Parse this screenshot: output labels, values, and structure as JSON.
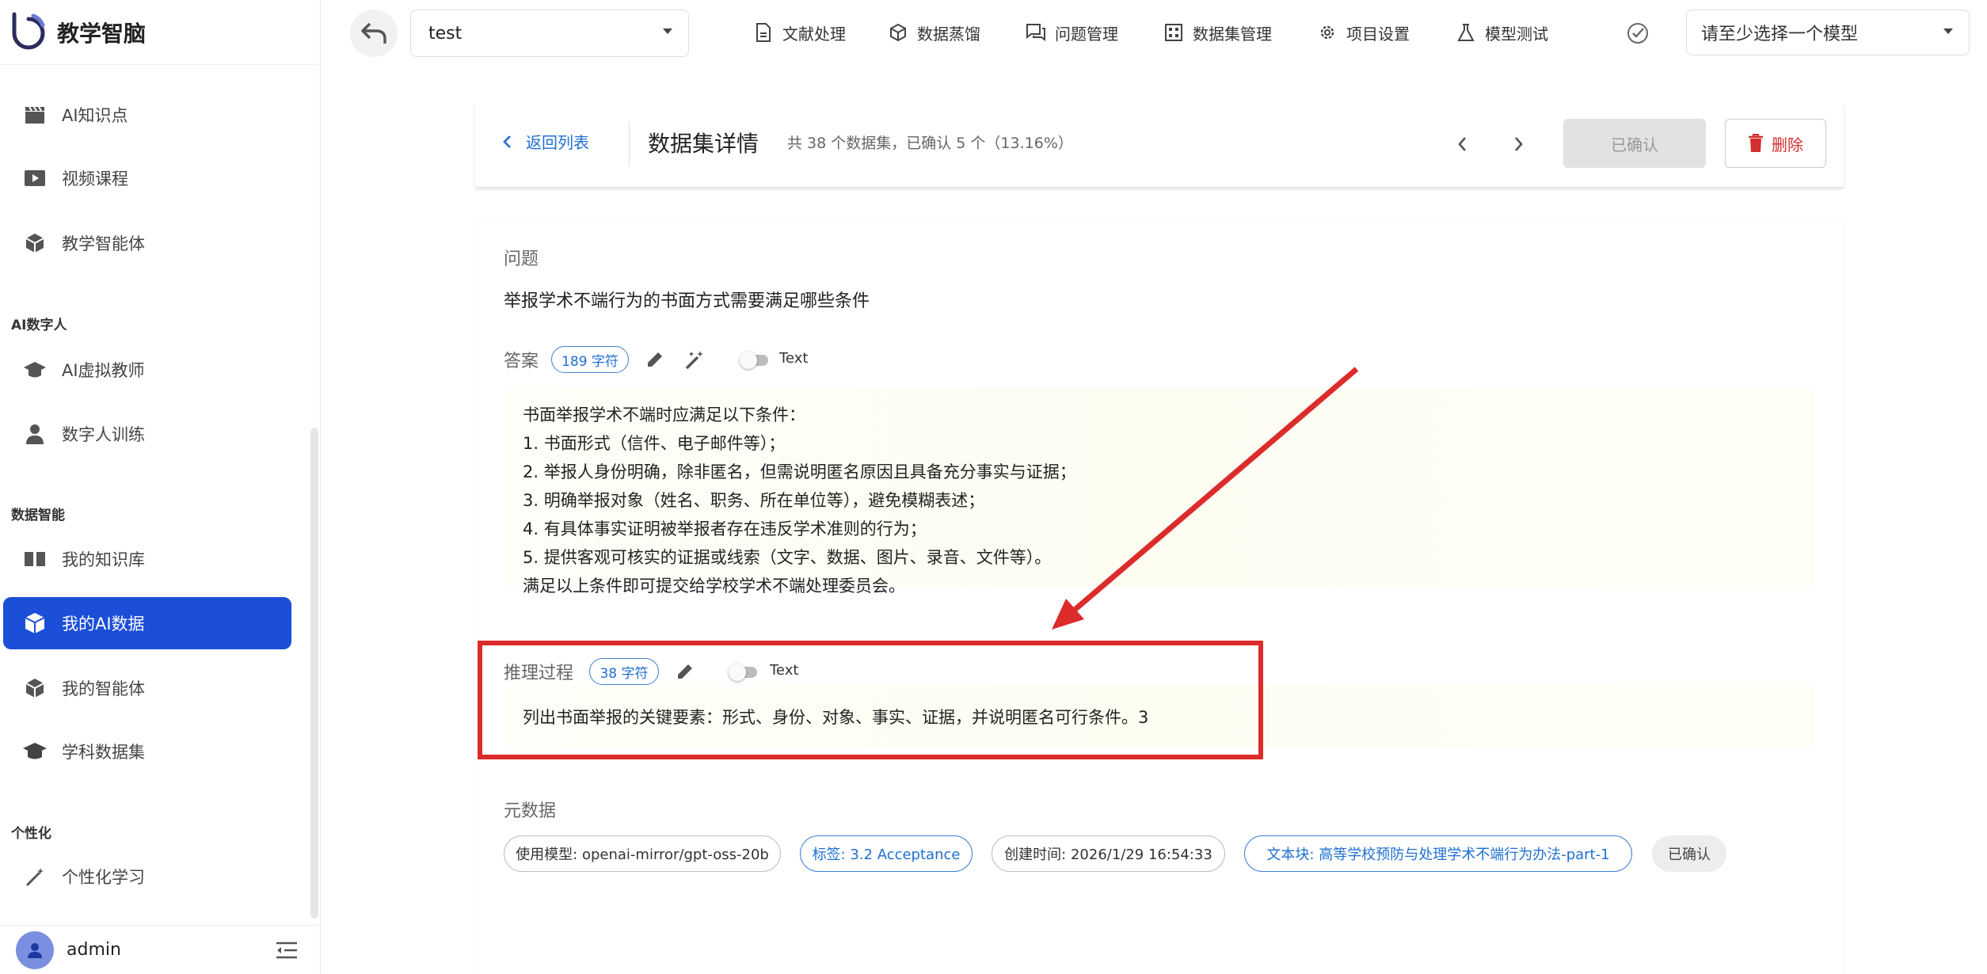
{
  "brand": {
    "title": "教学智脑"
  },
  "sidebar": {
    "items": [
      {
        "label": "AI知识点",
        "icon": "clapperboard-icon"
      },
      {
        "label": "视频课程",
        "icon": "video-play-icon"
      },
      {
        "label": "教学智能体",
        "icon": "cube-icon"
      },
      {
        "label": "AI虚拟教师",
        "icon": "graduation-cap-icon"
      },
      {
        "label": "数字人训练",
        "icon": "person-icon"
      },
      {
        "label": "我的知识库",
        "icon": "book-icon"
      },
      {
        "label": "我的AI数据",
        "icon": "cubes-icon"
      },
      {
        "label": "我的智能体",
        "icon": "cube-icon"
      },
      {
        "label": "学科数据集",
        "icon": "graduation-cap-icon"
      },
      {
        "label": "个性化学习",
        "icon": "magic-wand-icon"
      }
    ],
    "sections": [
      "AI数字人",
      "数据智能",
      "个性化"
    ],
    "active_index": 6
  },
  "user": {
    "name": "admin"
  },
  "topbar": {
    "project": "test",
    "menu": [
      "文献处理",
      "数据蒸馏",
      "问题管理",
      "数据集管理",
      "项目设置",
      "模型测试"
    ],
    "model_placeholder": "请至少选择一个模型"
  },
  "header": {
    "back_label": "返回列表",
    "title": "数据集详情",
    "subtitle": "共 38 个数据集，已确认 5 个（13.16%）",
    "confirm_label": "已确认",
    "delete_label": "删除"
  },
  "detail": {
    "question_label": "问题",
    "question": "举报学术不端行为的书面方式需要满足哪些条件",
    "answer_label": "答案",
    "answer_count": "189 字符",
    "toggle_label": "Text",
    "answer_lines": [
      "书面举报学术不端时应满足以下条件：",
      "1. 书面形式（信件、电子邮件等）；",
      "2. 举报人身份明确，除非匿名，但需说明匿名原因且具备充分事实与证据；",
      "3. 明确举报对象（姓名、职务、所在单位等），避免模糊表述；",
      "4. 有具体事实证明被举报者存在违反学术准则的行为；",
      "5. 提供客观可核实的证据或线索（文字、数据、图片、录音、文件等）。",
      "满足以上条件即可提交给学校学术不端处理委员会。"
    ],
    "reason_label": "推理过程",
    "reason_count": "38 字符",
    "reason_text": "列出书面举报的关键要素：形式、身份、对象、事实、证据，并说明匿名可行条件。3",
    "meta_label": "元数据",
    "meta": {
      "model": "使用模型: openai-mirror/gpt-oss-20b",
      "tag": "标签: 3.2 Acceptance",
      "created": "创建时间: 2026/1/29 16:54:33",
      "chunk": "文本块: 高等学校预防与处理学术不端行为办法-part-1",
      "status": "已确认"
    }
  },
  "colors": {
    "accent": "#1c4fd8",
    "link": "#1f6fd1",
    "danger": "#d32f2f",
    "annotation": "#dc2b2b"
  }
}
